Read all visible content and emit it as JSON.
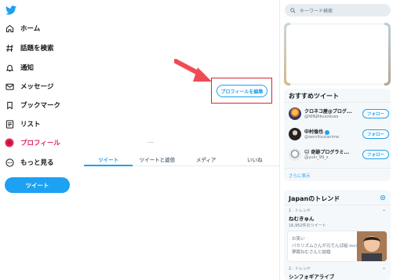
{
  "nav": {
    "items": [
      {
        "label": "ホーム",
        "icon": "home-icon"
      },
      {
        "label": "話題を検索",
        "icon": "hashtag-icon"
      },
      {
        "label": "通知",
        "icon": "bell-icon"
      },
      {
        "label": "メッセージ",
        "icon": "mail-icon"
      },
      {
        "label": "ブックマーク",
        "icon": "bookmark-icon"
      },
      {
        "label": "リスト",
        "icon": "list-icon"
      },
      {
        "label": "プロフィール",
        "icon": "profile-icon"
      },
      {
        "label": "もっと見る",
        "icon": "more-icon"
      }
    ],
    "tweet_button": "ツイート"
  },
  "profile": {
    "edit_button": "プロフィールを編集",
    "tabs": [
      "ツイート",
      "ツイートと返信",
      "メディア",
      "いいね"
    ]
  },
  "search": {
    "placeholder": "キーワード検索"
  },
  "recommendations": {
    "title": "おすすめツイート",
    "users": [
      {
        "name": "クロネコ屋@ブログ...",
        "handle": "@NINJAkusokuso",
        "follow": "フォロー"
      },
      {
        "name": "中村倫也",
        "handle": "@senritsutanime",
        "follow": "フォロー"
      },
      {
        "name": "🐱 奇跡プログラミ...",
        "handle": "@yuki_99_s",
        "follow": "フォロー"
      }
    ],
    "more_link": "さらに表示"
  },
  "trends": {
    "title": "Japanのトレンド",
    "items": [
      {
        "meta": "1 · トレンド",
        "name": "ねむきゅん",
        "count": "16,952件のツイート"
      },
      {
        "meta": "2 · トレンド",
        "name": "シンフォギアライブ"
      }
    ],
    "news": {
      "source": "お笑い",
      "text": "バカリズムさんが元でんぱ組.incの夢眠ねむさんと結婚"
    }
  },
  "colors": {
    "accent": "#1da1f2",
    "active": "#e0245e",
    "annotation": "#d9262e",
    "arrow": "#f04b54"
  }
}
